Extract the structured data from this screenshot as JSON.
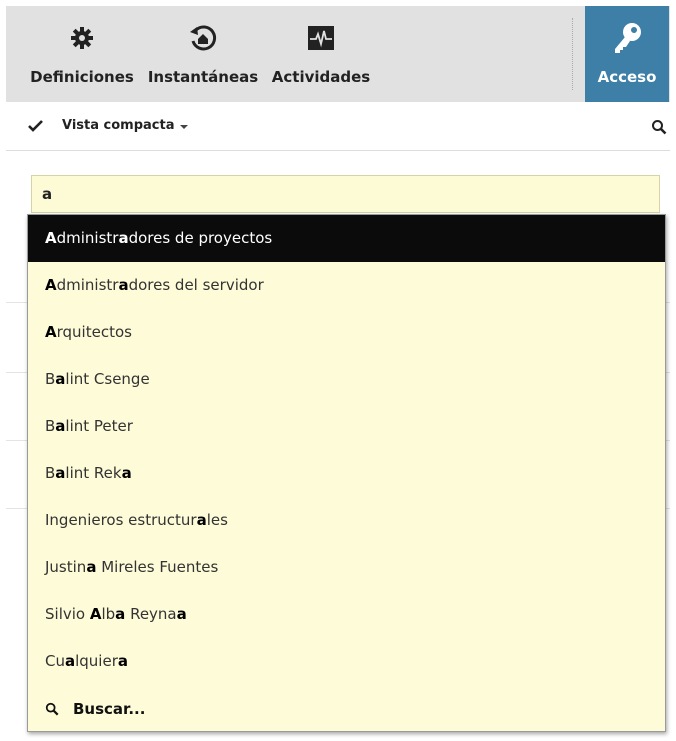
{
  "toolbar": {
    "tools": [
      {
        "label": "Definiciones",
        "icon": "gear-icon"
      },
      {
        "label": "Instantáneas",
        "icon": "snapshot-restore-icon"
      },
      {
        "label": "Actividades",
        "icon": "activity-monitor-icon"
      }
    ],
    "access": {
      "label": "Acceso",
      "icon": "key-icon"
    }
  },
  "viewbar": {
    "view_label": "Vista compacta",
    "check_icon": "check-icon",
    "caret_icon": "chevron-down-icon",
    "search_icon": "search-icon"
  },
  "search": {
    "value": "a"
  },
  "dropdown": {
    "items": [
      {
        "pre": "",
        "hl": "A",
        "mid": "dministr",
        "hl2": "a",
        "post": "dores de proyectos",
        "selected": true
      },
      {
        "pre": "",
        "hl": "A",
        "mid": "dministr",
        "hl2": "a",
        "post": "dores del servidor",
        "selected": false
      },
      {
        "pre": "",
        "hl": "A",
        "mid": "rquitectos",
        "hl2": "",
        "post": "",
        "selected": false
      },
      {
        "pre": "B",
        "hl": "a",
        "mid": "lint Csenge",
        "hl2": "",
        "post": "",
        "selected": false
      },
      {
        "pre": "B",
        "hl": "a",
        "mid": "lint Peter",
        "hl2": "",
        "post": "",
        "selected": false
      },
      {
        "pre": "B",
        "hl": "a",
        "mid": "lint Rek",
        "hl2": "a",
        "post": "",
        "selected": false
      },
      {
        "pre": "Ingenieros estructur",
        "hl": "a",
        "mid": "les",
        "hl2": "",
        "post": "",
        "selected": false
      },
      {
        "pre": "Justin",
        "hl": "a",
        "mid": " Mireles Fuentes",
        "hl2": "",
        "post": "",
        "selected": false
      },
      {
        "pre": "Silvio ",
        "hl": "A",
        "mid": "lb",
        "hl2": "a",
        "post": " Reyna",
        "selected": false,
        "tail_hl": "a"
      },
      {
        "pre": "Cu",
        "hl": "a",
        "mid": "lquier",
        "hl2": "a",
        "post": "",
        "selected": false
      }
    ],
    "search_more": "Buscar..."
  },
  "colors": {
    "access_bg": "#3d7fa6",
    "toolbar_bg": "#e1e1e1",
    "dropdown_bg": "#fefbd8",
    "selected_bg": "#0b0b0b"
  }
}
